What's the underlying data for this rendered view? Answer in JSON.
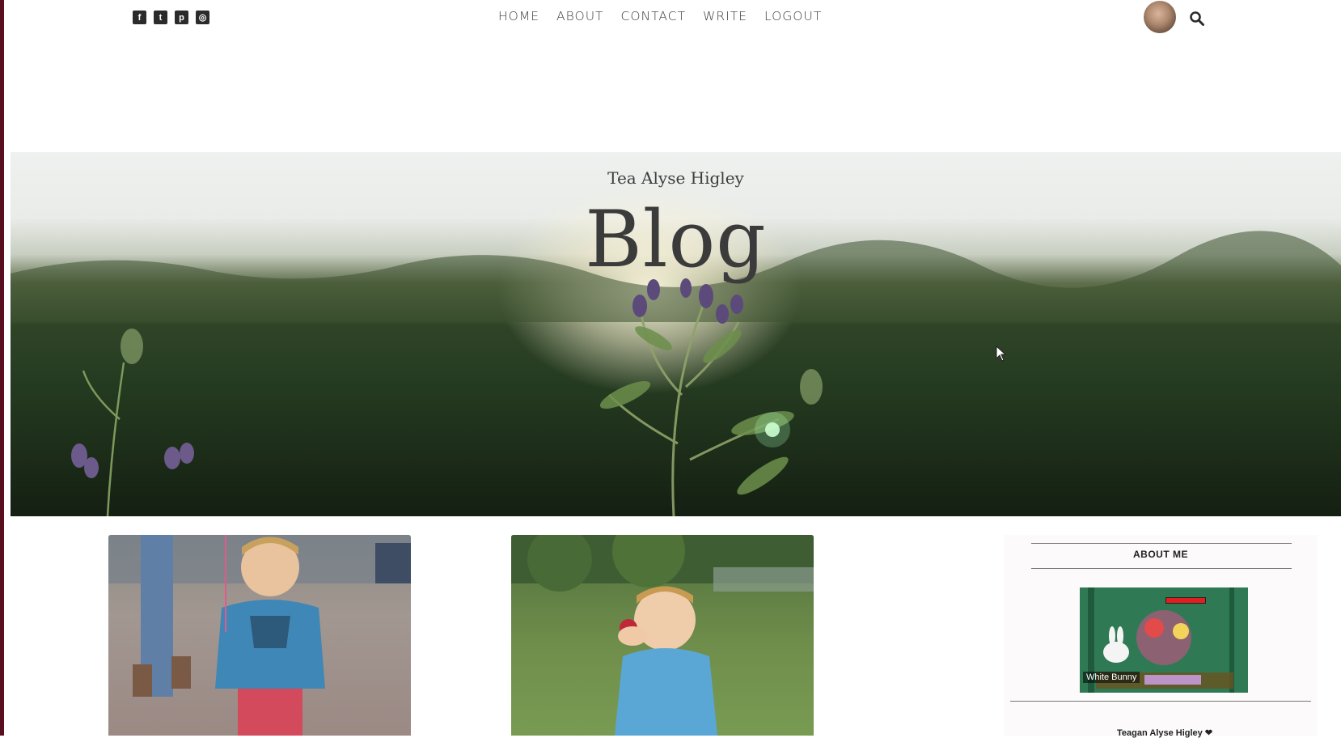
{
  "header": {
    "social_icons": [
      {
        "name": "facebook-icon",
        "glyph": "f"
      },
      {
        "name": "twitter-icon",
        "glyph": "t"
      },
      {
        "name": "pinterest-icon",
        "glyph": "p"
      },
      {
        "name": "instagram-icon",
        "glyph": "◎"
      }
    ],
    "nav": [
      "HOME",
      "ABOUT",
      "CONTACT",
      "WRITE",
      "LOGOUT"
    ]
  },
  "hero": {
    "subtitle": "Tea Alyse Higley",
    "title": "Blog"
  },
  "sidebar": {
    "heading": "ABOUT ME",
    "image_caption": "White Bunny",
    "name_line": "Teagan Alyse Higley ❤"
  }
}
